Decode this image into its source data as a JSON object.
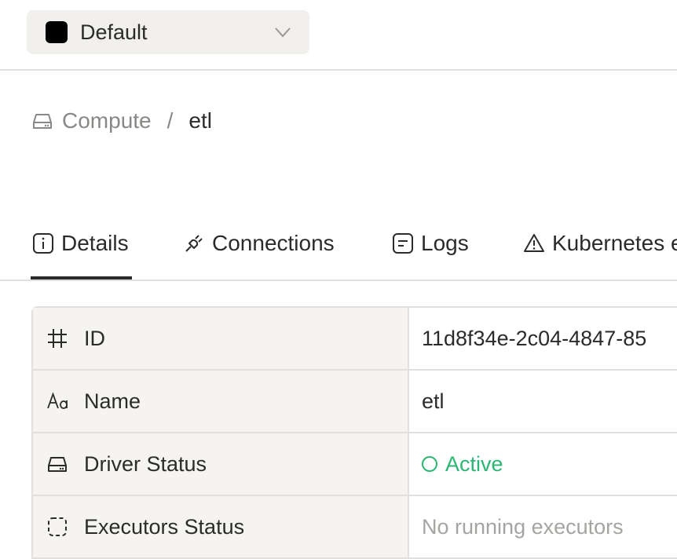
{
  "workspace": {
    "name": "Default",
    "swatch_color": "#000000"
  },
  "breadcrumb": {
    "parent": "Compute",
    "separator": "/",
    "current": "etl"
  },
  "tabs": [
    {
      "label": "Details",
      "icon": "info-icon",
      "active": true
    },
    {
      "label": "Connections",
      "icon": "plug-icon",
      "active": false
    },
    {
      "label": "Logs",
      "icon": "log-icon",
      "active": false
    },
    {
      "label": "Kubernetes e",
      "icon": "warning-icon",
      "active": false
    }
  ],
  "details": {
    "rows": [
      {
        "label": "ID",
        "icon": "hash-icon",
        "value": "11d8f34e-2c04-4847-85"
      },
      {
        "label": "Name",
        "icon": "text-icon",
        "value": "etl"
      },
      {
        "label": "Driver Status",
        "icon": "drive-icon",
        "value": "Active"
      },
      {
        "label": "Executors Status",
        "icon": "dashed-square-icon",
        "value": "No running executors"
      }
    ]
  },
  "colors": {
    "accent_active": "#2bb673",
    "muted": "#a6a4a0",
    "border": "#e2e0dc"
  }
}
